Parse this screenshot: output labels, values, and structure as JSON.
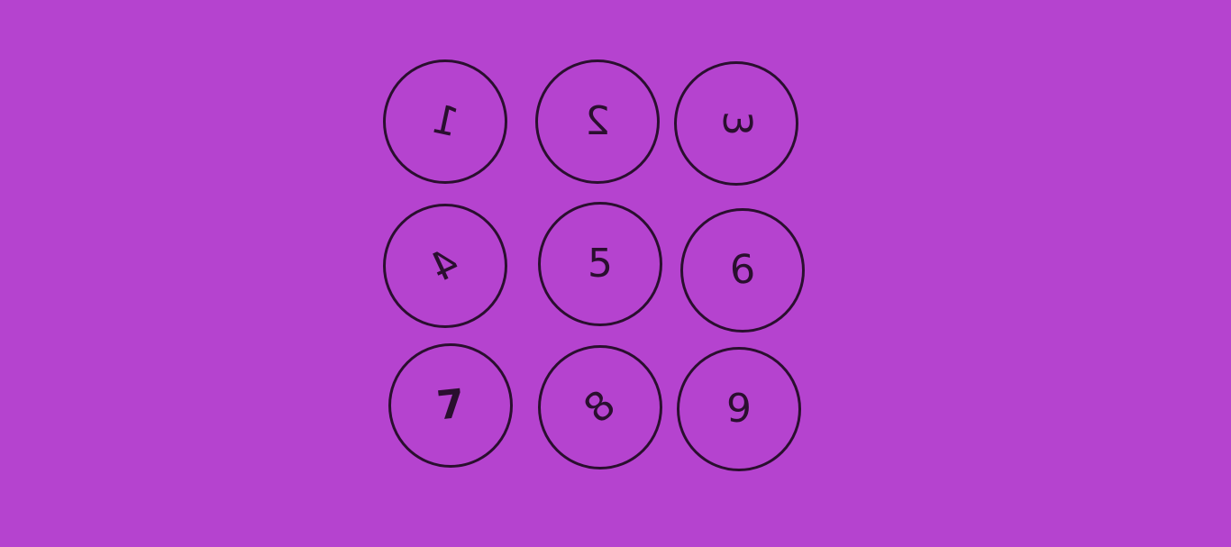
{
  "colors": {
    "background": "#b543cf",
    "stroke": "#2a0f2f"
  },
  "grid": {
    "cells": [
      {
        "digit": "1"
      },
      {
        "digit": "2"
      },
      {
        "digit": "3"
      },
      {
        "digit": "4"
      },
      {
        "digit": "5"
      },
      {
        "digit": "6"
      },
      {
        "digit": "7"
      },
      {
        "digit": "8"
      },
      {
        "digit": "9"
      }
    ]
  }
}
